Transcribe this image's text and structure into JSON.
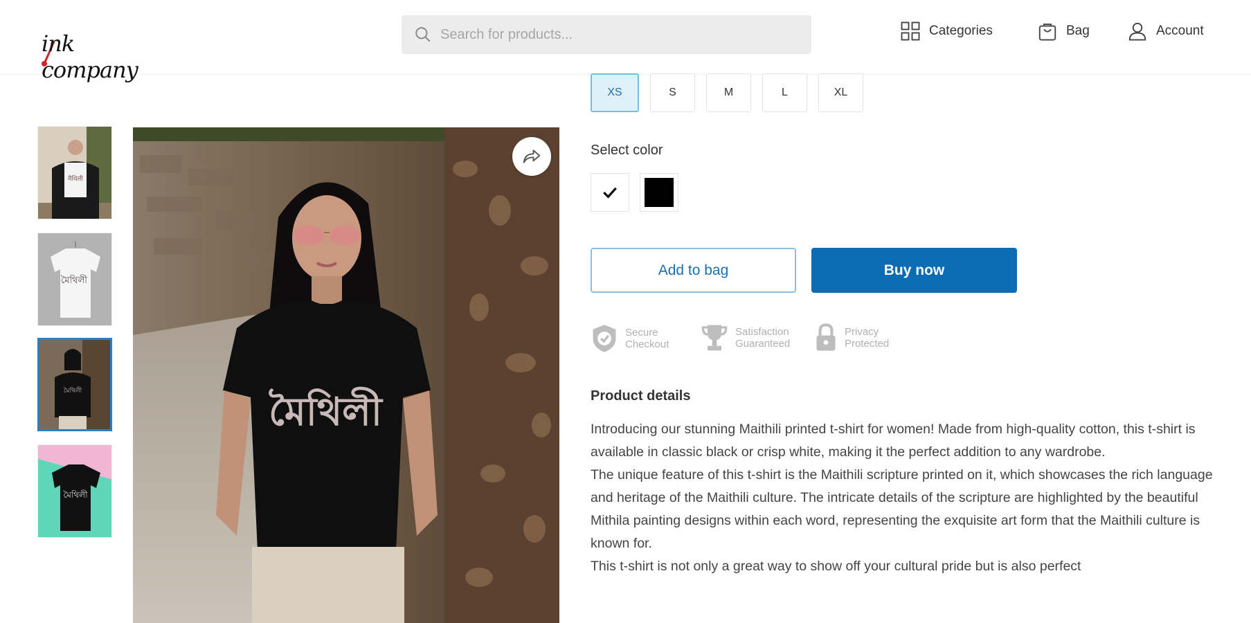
{
  "header": {
    "logo_text": "ink company",
    "search_placeholder": "Search for products...",
    "nav": {
      "categories": "Categories",
      "bag": "Bag",
      "account": "Account"
    }
  },
  "product": {
    "sizes": [
      "XS",
      "S",
      "M",
      "L",
      "XL"
    ],
    "selected_size": "XS",
    "color_label": "Select color",
    "colors": [
      {
        "name": "white",
        "hex": "#ffffff",
        "selected": true
      },
      {
        "name": "black",
        "hex": "#000000",
        "selected": false
      }
    ],
    "add_to_bag": "Add to bag",
    "buy_now": "Buy now",
    "badges": [
      {
        "icon": "shield-check-icon",
        "line1": "Secure",
        "line2": "Checkout"
      },
      {
        "icon": "trophy-icon",
        "line1": "Satisfaction",
        "line2": "Guaranteed"
      },
      {
        "icon": "lock-icon",
        "line1": "Privacy",
        "line2": "Protected"
      }
    ],
    "details_title": "Product details",
    "description": [
      "Introducing our stunning Maithili printed t-shirt for women! Made from high-quality cotton, this t-shirt is available in classic black or crisp white, making it the perfect addition to any wardrobe.",
      "The unique feature of this t-shirt is the Maithili scripture printed on it, which showcases the rich language and heritage of the Maithili culture. The intricate details of the scripture are highlighted by the beautiful Mithila painting designs within each word, representing the exquisite art form that the Maithili culture is known for.",
      "This t-shirt is not only a great way to show off your cultural pride but is also perfect"
    ],
    "tshirt_print": "মৈথিলী",
    "thumbnails": [
      "white tee on model",
      "white tee on hanger",
      "black tee on model",
      "black tee on hanger"
    ],
    "selected_thumbnail": 2
  },
  "colors": {
    "primary": "#0c6bb3",
    "selected_size_bg": "#dff0f8"
  }
}
